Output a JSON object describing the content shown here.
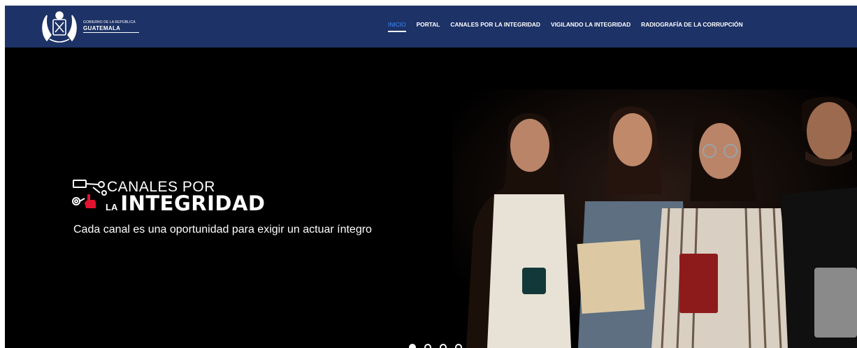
{
  "header": {
    "brand_small": "GOBIERNO DE LA REPÚBLICA",
    "brand_big": "GUATEMALA",
    "nav": [
      {
        "label": "INICIO",
        "active": true
      },
      {
        "label": "PORTAL",
        "active": false
      },
      {
        "label": "CANALES POR LA INTEGRIDAD",
        "active": false
      },
      {
        "label": "VIGILANDO LA INTEGRIDAD",
        "active": false
      },
      {
        "label": "RADIOGRAFÍA DE LA CORRUPCIÓN",
        "active": false
      }
    ]
  },
  "hero": {
    "logo_top": "CANALES POR",
    "logo_la": "LA",
    "logo_bottom": "INTEGRIDAD",
    "subtitle": "Cada canal es una oportunidad para exigir un actuar íntegro",
    "slides": 4,
    "active_slide": 1
  },
  "colors": {
    "navbar": "#1d3266",
    "active_link": "#3a8dff",
    "hero_bg": "#000000",
    "accent_red": "#e0142e"
  }
}
